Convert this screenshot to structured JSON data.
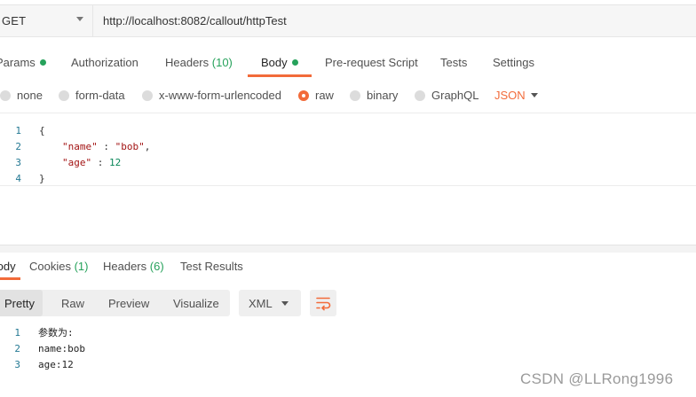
{
  "request": {
    "method": "GET",
    "url": "http://localhost:8082/callout/httpTest"
  },
  "request_tabs": [
    {
      "label": "Params",
      "count": "",
      "dot": true,
      "active": false
    },
    {
      "label": "Authorization",
      "count": "",
      "dot": false,
      "active": false
    },
    {
      "label": "Headers",
      "count": "(10)",
      "dot": false,
      "active": false
    },
    {
      "label": "Body",
      "count": "",
      "dot": true,
      "active": true
    },
    {
      "label": "Pre-request Script",
      "count": "",
      "dot": false,
      "active": false
    },
    {
      "label": "Tests",
      "count": "",
      "dot": false,
      "active": false
    },
    {
      "label": "Settings",
      "count": "",
      "dot": false,
      "active": false
    }
  ],
  "body_types": {
    "options": [
      "none",
      "form-data",
      "x-www-form-urlencoded",
      "raw",
      "binary",
      "GraphQL"
    ],
    "selected": "raw",
    "format": "JSON"
  },
  "editor": {
    "line_numbers": [
      "1",
      "2",
      "3",
      "4"
    ],
    "lines": {
      "open_brace": "{",
      "key1": "\"name\"",
      "sep1": " : ",
      "val1": "\"bob\"",
      "comma1": ",",
      "key2": "\"age\"",
      "sep2": " : ",
      "val2": "12",
      "close_brace": "}"
    }
  },
  "response_tabs": [
    {
      "label": "Body",
      "count": "",
      "active": true
    },
    {
      "label": "Cookies",
      "count": "(1)",
      "active": false
    },
    {
      "label": "Headers",
      "count": "(6)",
      "active": false
    },
    {
      "label": "Test Results",
      "count": "",
      "active": false
    }
  ],
  "view_modes": {
    "options": [
      "Pretty",
      "Raw",
      "Preview",
      "Visualize"
    ],
    "selected": "Pretty",
    "language": "XML"
  },
  "response_body": {
    "line_numbers": [
      "1",
      "2",
      "3"
    ],
    "lines": [
      "参数为:",
      "name:bob",
      "age:12"
    ]
  },
  "watermark": "CSDN @LLRong1996",
  "colors": {
    "accent": "#f26b3a",
    "count_green": "#26a25b",
    "line_number": "#237893"
  },
  "icons": {
    "method_dropdown": "chevron-down-icon",
    "format_dropdown": "chevron-down-icon",
    "language_dropdown": "chevron-down-icon",
    "wrap_button": "wrap-lines-icon"
  }
}
